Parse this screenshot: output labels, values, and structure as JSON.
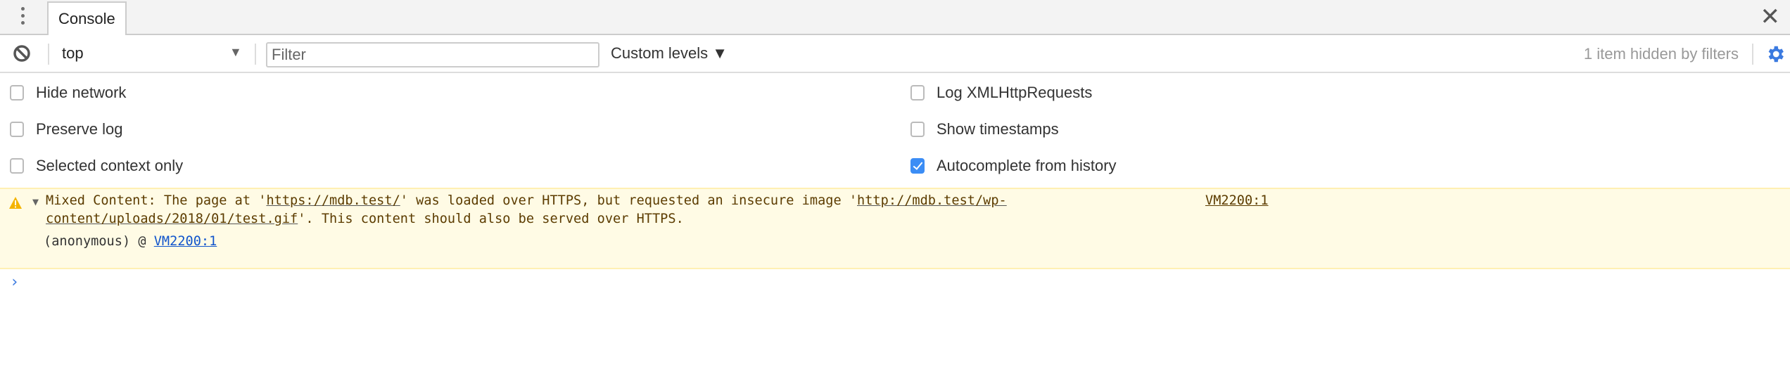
{
  "tabbar": {
    "tab_label": "Console",
    "menu_icon": "vertical-dots-icon",
    "close_icon": "close-icon"
  },
  "toolbar": {
    "clear_icon": "block-icon",
    "context": "top",
    "filter_placeholder": "Filter",
    "levels_label": "Custom levels ▼",
    "hidden_status": "1 item hidden by filters",
    "settings_icon": "gear-icon",
    "accent": "#3b8df5"
  },
  "settings": {
    "left": [
      {
        "label": "Hide network",
        "checked": false
      },
      {
        "label": "Preserve log",
        "checked": false
      },
      {
        "label": "Selected context only",
        "checked": false
      }
    ],
    "right": [
      {
        "label": "Log XMLHttpRequests",
        "checked": false
      },
      {
        "label": "Show timestamps",
        "checked": false
      },
      {
        "label": "Autocomplete from history",
        "checked": true
      }
    ]
  },
  "messages": [
    {
      "level": "warning",
      "prefix": "Mixed Content: The page at '",
      "url1": "https://mdb.test/",
      "middle": "' was loaded over HTTPS, but requested an insecure image '",
      "url2": "http://mdb.test/wp-content/uploads/2018/01/test.gif",
      "suffix": "'. This content should also be served over HTTPS.",
      "source": "VM2200:1",
      "stack_frame": "(anonymous) @ ",
      "stack_link": "VM2200:1"
    }
  ],
  "prompt_symbol": "›"
}
